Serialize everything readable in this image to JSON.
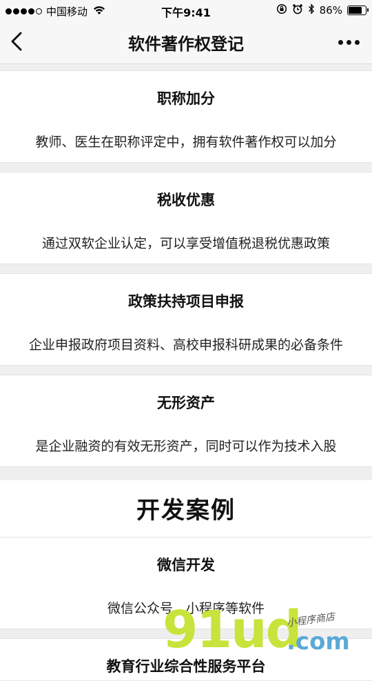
{
  "status_bar": {
    "carrier": "中国移动",
    "time": "下午9:41",
    "battery_percent": "86%",
    "battery_level": 0.86
  },
  "nav": {
    "title": "软件著作权登记"
  },
  "cards": [
    {
      "title": "职称加分",
      "desc": "教师、医生在职称评定中，拥有软件著作权可以加分"
    },
    {
      "title": "税收优惠",
      "desc": "通过双软企业认定，可以享受增值税退税优惠政策"
    },
    {
      "title": "政策扶持项目申报",
      "desc": "企业申报政府项目资料、高校申报科研成果的必备条件"
    },
    {
      "title": "无形资产",
      "desc": "是企业融资的有效无形资产，同时可以作为技术入股"
    }
  ],
  "section": {
    "title": "开发案例"
  },
  "cases": [
    {
      "title": "微信开发",
      "desc": "微信公众号、小程序等软件"
    },
    {
      "title": "教育行业综合性服务平台",
      "desc": ""
    }
  ],
  "watermark": {
    "brand": "91ud",
    "domain": ".com",
    "tagline": "小程序商店"
  }
}
